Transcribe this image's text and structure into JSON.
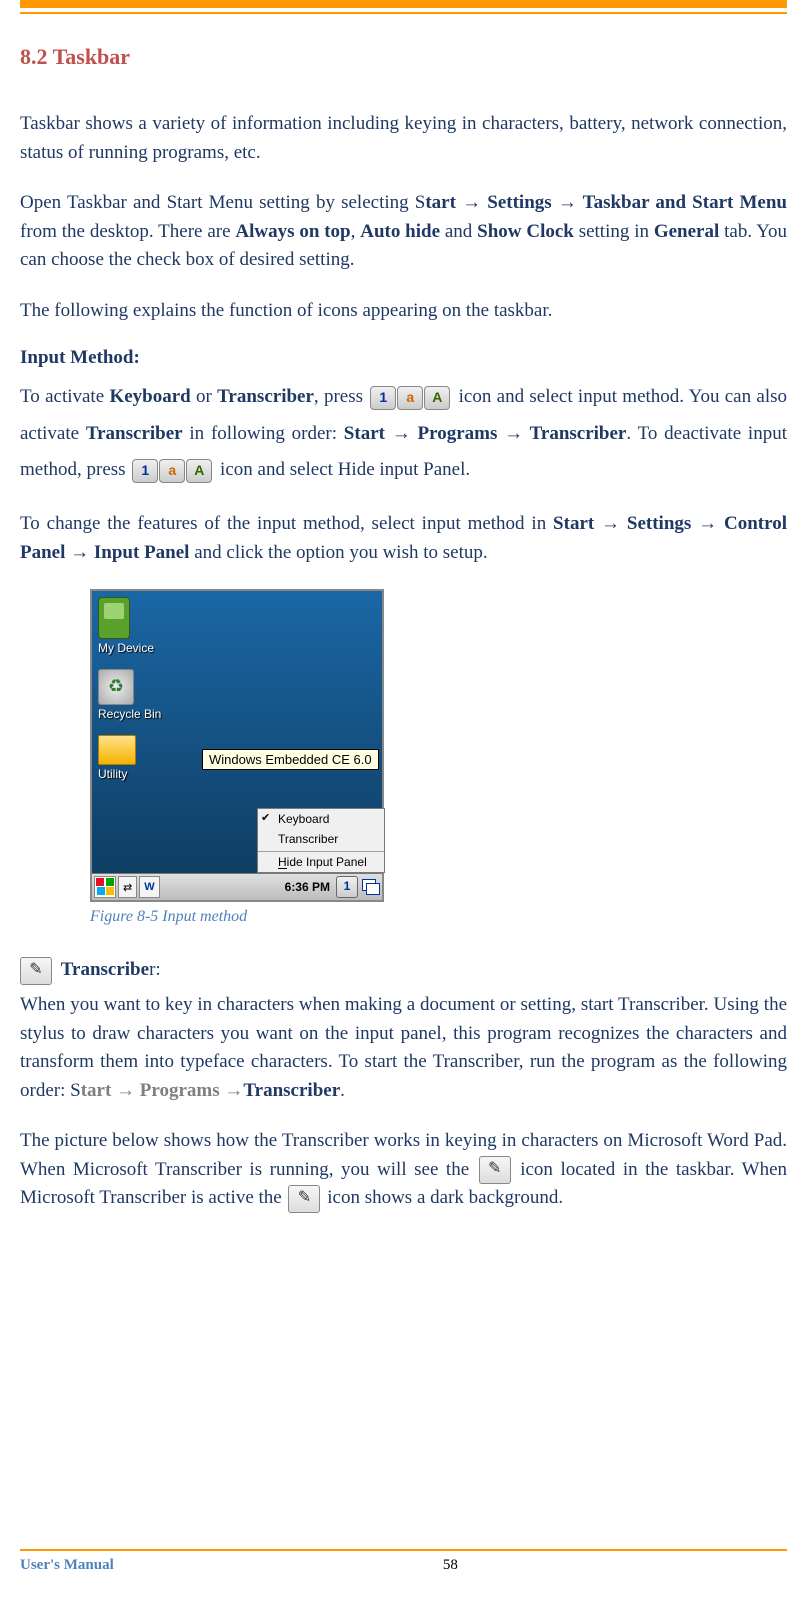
{
  "section": {
    "number": "8.2",
    "title": "Taskbar"
  },
  "para1": "Taskbar shows a variety of information including keying in characters, battery, network connection, status of running programs, etc.",
  "para2": {
    "lead": "Open Taskbar and Start Menu setting by selecting S",
    "tart": "tart",
    "arrow1": " → ",
    "settings": "Settings",
    "arrow2": " → ",
    "tsm": " Taskbar and Start Menu",
    "mid1": " from the desktop. There are ",
    "aot": "Always on top",
    "comma": ", ",
    "autohide": "Auto hide",
    "and": " and ",
    "showclock": "Show Clock",
    "mid2": " setting in ",
    "general": "General",
    "tail": " tab. You can choose the check box of desired setting."
  },
  "para3": " The following explains the function of icons appearing on the taskbar.",
  "input_method_heading": "Input Method:",
  "para4": {
    "a": "To activate ",
    "kb": "Keyboard",
    "b": " or ",
    "tr": "Transcriber",
    "c": ", press ",
    "d": "icon and select input method. You can also activate ",
    "tr2": "Transcriber",
    "e": "  in following order: ",
    "start": "Start",
    "arr1": " → ",
    "programs": "Programs",
    "arr2": " → ",
    "tr3": "Transcriber",
    "f": ". To deactivate input method, press ",
    "g": "icon and select Hide input Panel."
  },
  "para5": {
    "a": "To change the features of the input method, select input method in ",
    "start": "Start",
    "arr1": " → ",
    "settings": "Settings",
    "arr2": " → ",
    "cp": "Control Panel",
    "arr3": " → ",
    "ip": "Input Panel",
    "b": " and click the option you wish to setup."
  },
  "screenshot": {
    "desktop": {
      "mydevice": "My Device",
      "recycle": "Recycle Bin",
      "utility": "Utility",
      "tooltip": "Windows Embedded CE 6.0"
    },
    "menu": {
      "keyboard": "Keyboard",
      "transcriber": "Transcriber",
      "hide_first_letter": "H"
    },
    "taskbar": {
      "app_letter": "W",
      "time": "6:36 PM",
      "input_icon": "1"
    }
  },
  "figure_caption": "Figure 8-5 Input method",
  "transcriber_label": "Transcribe",
  "transcriber_label_tail": "r:",
  "para6": {
    "a": "When you want to key in characters when making a document or setting, start Transcriber. Using the stylus to draw characters you want on the input panel, this program recognizes the characters and transform them into typeface characters. To start the Transcriber, run the program as the following order: S",
    "tart": "tart",
    "arr1": " → ",
    "programs": "Programs",
    "arr2": " →",
    "tr": "Transcriber",
    "dot": "."
  },
  "para7": {
    "a": "The picture below shows how the Transcriber works in keying in characters on Microsoft Word Pad. When Microsoft Transcriber is running, you will see the ",
    "b": " icon located in the taskbar. When Microsoft Transcriber is active the ",
    "c": " icon shows a dark background."
  },
  "footer": {
    "left": "User's Manual",
    "page": "58"
  },
  "icons": {
    "box1": "1",
    "box2": "a",
    "box3": "A"
  }
}
